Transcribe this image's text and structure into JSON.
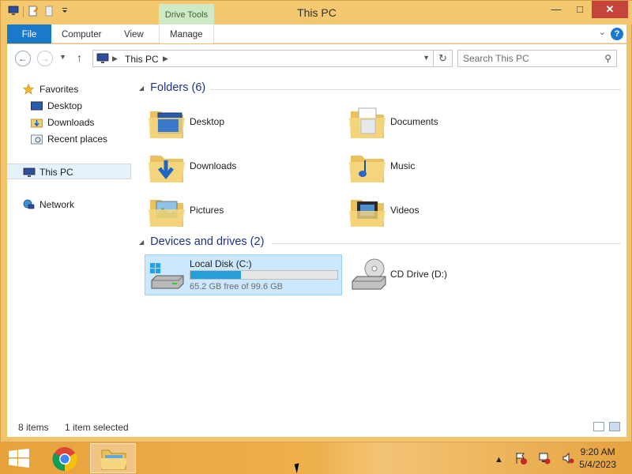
{
  "window": {
    "title": "This PC",
    "context_tab_group": "Drive Tools",
    "controls": {
      "minimize": "—",
      "maximize": "□",
      "close": "✕"
    }
  },
  "ribbon": {
    "tabs": [
      {
        "label": "File",
        "active": true
      },
      {
        "label": "Computer"
      },
      {
        "label": "View"
      },
      {
        "label": "Manage"
      }
    ],
    "help": "?"
  },
  "navbar": {
    "address_crumb": "This PC",
    "search_placeholder": "Search This PC"
  },
  "navpane": {
    "favorites": {
      "label": "Favorites",
      "items": [
        {
          "label": "Desktop",
          "icon": "desktop-icon"
        },
        {
          "label": "Downloads",
          "icon": "downloads-icon"
        },
        {
          "label": "Recent places",
          "icon": "recent-places-icon"
        }
      ]
    },
    "this_pc": {
      "label": "This PC",
      "selected": true
    },
    "network": {
      "label": "Network"
    }
  },
  "main": {
    "folders_group": {
      "header": "Folders (6)",
      "items": [
        {
          "label": "Desktop",
          "icon": "desktop-folder-icon"
        },
        {
          "label": "Documents",
          "icon": "documents-folder-icon"
        },
        {
          "label": "Downloads",
          "icon": "downloads-folder-icon"
        },
        {
          "label": "Music",
          "icon": "music-folder-icon"
        },
        {
          "label": "Pictures",
          "icon": "pictures-folder-icon"
        },
        {
          "label": "Videos",
          "icon": "videos-folder-icon"
        }
      ]
    },
    "drives_group": {
      "header": "Devices and drives (2)",
      "items": [
        {
          "label": "Local Disk (C:)",
          "free_text": "65.2 GB free of 99.6 GB",
          "used_fraction": 0.345,
          "selected": true,
          "icon": "local-disk-icon"
        },
        {
          "label": "CD Drive (D:)",
          "icon": "cd-drive-icon"
        }
      ]
    }
  },
  "statusbar": {
    "item_count": "8 items",
    "selection": "1 item selected"
  },
  "taskbar": {
    "apps": [
      {
        "name": "Google Chrome",
        "icon": "chrome-icon"
      },
      {
        "name": "File Explorer",
        "icon": "file-explorer-icon",
        "active": true
      }
    ],
    "clock_time": "9:20 AM",
    "clock_date": "5/4/2023"
  },
  "colors": {
    "accent": "#1979ca",
    "window_frame": "#f0c46a",
    "selection": "#cce8ff",
    "drive_bar": "#26a0da"
  }
}
